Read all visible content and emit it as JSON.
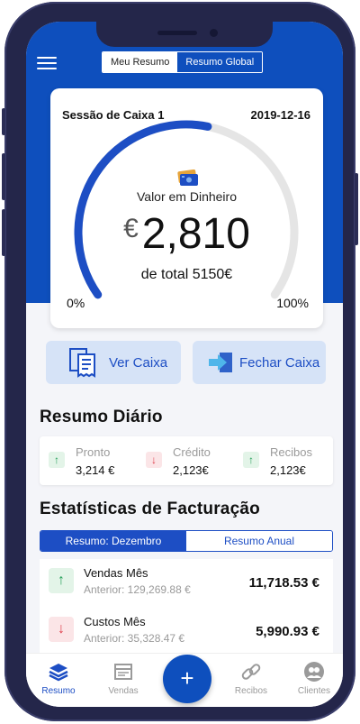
{
  "toggle": {
    "meu_resumo": "Meu Resumo",
    "resumo_global": "Resumo Global"
  },
  "card": {
    "session_label": "Sessão de Caixa 1",
    "date": "2019-12-16",
    "valor_label": "Valor em Dinheiro",
    "currency_symbol": "€",
    "amount": "2,810",
    "total_label": "de total 5150€",
    "pct_min": "0%",
    "pct_max": "100%",
    "gauge_fraction": 0.546
  },
  "actions": {
    "ver_caixa": "Ver Caixa",
    "fechar_caixa": "Fechar Caixa"
  },
  "resumo_diario": {
    "title": "Resumo Diário",
    "items": [
      {
        "label": "Pronto",
        "value": "3,214 €",
        "direction": "up"
      },
      {
        "label": "Crédito",
        "value": "2,123€",
        "direction": "down"
      },
      {
        "label": "Recibos",
        "value": "2,123€",
        "direction": "up"
      }
    ]
  },
  "estatisticas": {
    "title": "Estatísticas de Facturação",
    "tabs": {
      "active": "Resumo: Dezembro",
      "inactive": "Resumo Anual"
    },
    "rows": [
      {
        "name": "Vendas Mês",
        "previous": "Anterior: 129,269.88 €",
        "amount": "11,718.53 €",
        "direction": "up"
      },
      {
        "name": "Custos Mês",
        "previous": "Anterior: 35,328.47 €",
        "amount": "5,990.93 €",
        "direction": "down"
      }
    ]
  },
  "nav": {
    "resumo": "Resumo",
    "vendas": "Vendas",
    "fab": "+",
    "recibos": "Recibos",
    "clientes": "Clientes"
  },
  "colors": {
    "primary": "#0e4fbd",
    "accent": "#1d4ec4",
    "up": "#26a05a",
    "down": "#e0414e"
  }
}
